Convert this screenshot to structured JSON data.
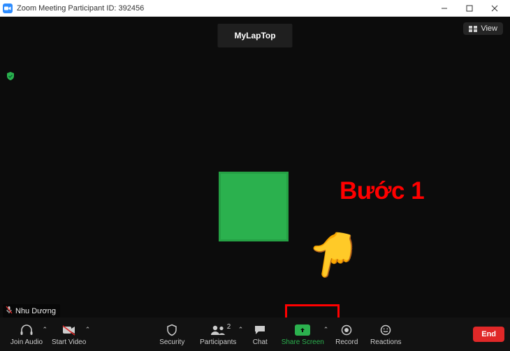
{
  "titlebar": {
    "text": "Zoom Meeting Participant ID: 392456"
  },
  "view_button": {
    "label": "View"
  },
  "participant_plate": {
    "name": "MyLapTop"
  },
  "self": {
    "name": "Nhu Dương"
  },
  "annotation": {
    "step_text": "Bước 1"
  },
  "toolbar": {
    "join_audio": "Join Audio",
    "start_video": "Start Video",
    "security": "Security",
    "participants": "Participants",
    "participants_count": "2",
    "chat": "Chat",
    "share_screen": "Share Screen",
    "record": "Record",
    "reactions": "Reactions",
    "end": "End"
  }
}
